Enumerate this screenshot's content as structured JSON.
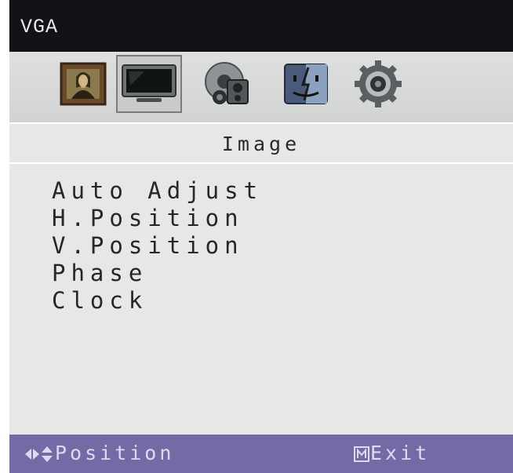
{
  "header": {
    "source_label": "VGA"
  },
  "icons": [
    {
      "name": "picture-icon",
      "selected": false
    },
    {
      "name": "image-monitor-icon",
      "selected": true
    },
    {
      "name": "audio-icon",
      "selected": false
    },
    {
      "name": "mac-face-icon",
      "selected": false
    },
    {
      "name": "setup-gear-icon",
      "selected": false
    }
  ],
  "section": {
    "title": "Image"
  },
  "menu": {
    "items": [
      "Auto Adjust",
      "H.Position",
      "V.Position",
      "Phase",
      "Clock"
    ]
  },
  "footer": {
    "left_hint": "Position",
    "right_hint": "Exit"
  },
  "colors": {
    "title_bar": "#121218",
    "panel": "#e6e7e6",
    "footer": "#7569a6"
  }
}
